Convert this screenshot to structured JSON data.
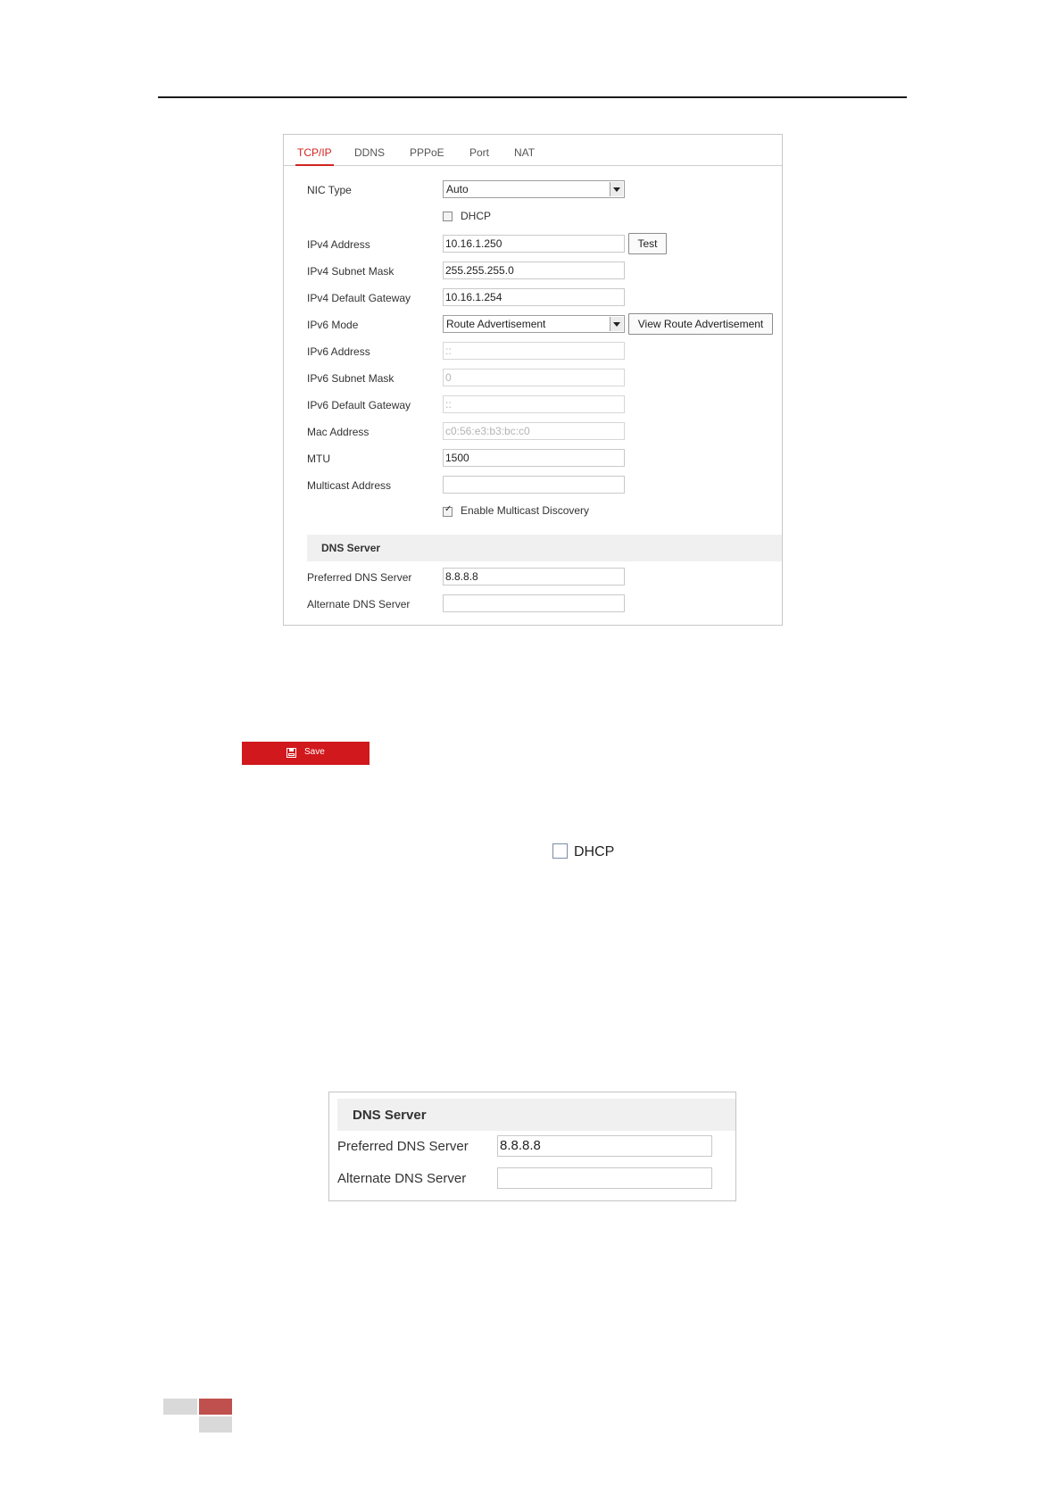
{
  "tabs": [
    "TCP/IP",
    "DDNS",
    "PPPoE",
    "Port",
    "NAT"
  ],
  "form": {
    "nic_type_label": "NIC Type",
    "nic_type_value": "Auto",
    "dhcp_label": "DHCP",
    "dhcp_checked": false,
    "ipv4_address_label": "IPv4 Address",
    "ipv4_address_value": "10.16.1.250",
    "test_button": "Test",
    "ipv4_subnet_label": "IPv4 Subnet Mask",
    "ipv4_subnet_value": "255.255.255.0",
    "ipv4_gateway_label": "IPv4 Default Gateway",
    "ipv4_gateway_value": "10.16.1.254",
    "ipv6_mode_label": "IPv6 Mode",
    "ipv6_mode_value": "Route Advertisement",
    "view_route_button": "View Route Advertisement",
    "ipv6_address_label": "IPv6 Address",
    "ipv6_address_value": "::",
    "ipv6_subnet_label": "IPv6 Subnet Mask",
    "ipv6_subnet_value": "0",
    "ipv6_gateway_label": "IPv6 Default Gateway",
    "ipv6_gateway_value": "::",
    "mac_label": "Mac Address",
    "mac_value": "c0:56:e3:b3:bc:c0",
    "mtu_label": "MTU",
    "mtu_value": "1500",
    "multicast_label": "Multicast Address",
    "multicast_value": "",
    "multicast_discovery_label": "Enable Multicast Discovery",
    "multicast_discovery_checked": true
  },
  "dns": {
    "section_title": "DNS Server",
    "preferred_label": "Preferred DNS Server",
    "preferred_value": "8.8.8.8",
    "alternate_label": "Alternate DNS Server",
    "alternate_value": ""
  },
  "save_button": "Save",
  "inline_dhcp": {
    "label": "DHCP"
  },
  "dns_zoom": {
    "section_title": "DNS Server",
    "preferred_label": "Preferred DNS Server",
    "preferred_value": "8.8.8.8",
    "alternate_label": "Alternate DNS Server",
    "alternate_value": ""
  },
  "colors": {
    "accent": "#d1241f",
    "save_button": "#d0181d",
    "footer_red": "#c0504d",
    "footer_gray": "#d9d9d9"
  }
}
